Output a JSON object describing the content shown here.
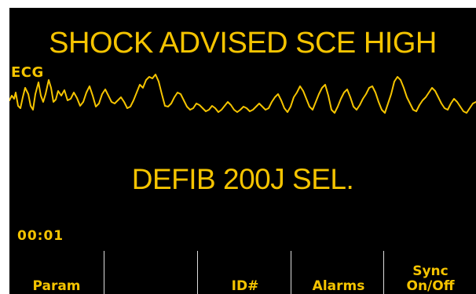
{
  "colors": {
    "display_text": "#f5c400",
    "waveform": "#f5c400",
    "background": "#000000",
    "divider": "#dcdcdc"
  },
  "status": {
    "alert_message": "SHOCK ADVISED SCE HIGH",
    "energy_message": "DEFIB 200J SEL.",
    "elapsed_time": "00:01"
  },
  "waveform": {
    "lead_label": "ECG"
  },
  "softkeys": [
    {
      "label": "Param"
    },
    {
      "label": ""
    },
    {
      "label": "ID#"
    },
    {
      "label": "Alarms"
    },
    {
      "label": "Sync\nOn/Off"
    }
  ]
}
